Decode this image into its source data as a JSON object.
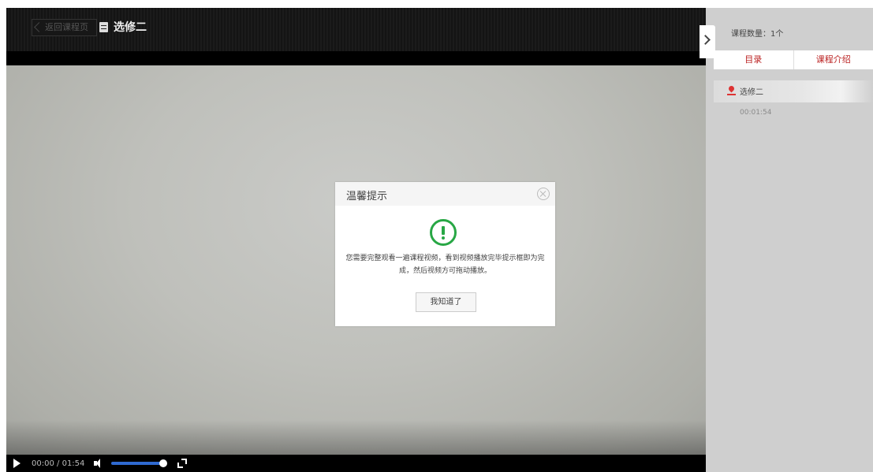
{
  "header": {
    "back_label": "返回课程页",
    "course_title": "选修二"
  },
  "player": {
    "current_time": "00:00",
    "separator": "/",
    "duration": "01:54"
  },
  "sidebar": {
    "course_count": "课程数量：1个",
    "tabs": [
      {
        "label": "目录"
      },
      {
        "label": "课程介绍"
      }
    ],
    "items": [
      {
        "label": "选修二",
        "duration": "00:01:54"
      }
    ]
  },
  "dialog": {
    "title": "温馨提示",
    "message": "您需要完整观看一遍课程视频，看到视频播放完毕提示框即为完成，然后视频方可拖动播放。",
    "ok_label": "我知道了"
  }
}
